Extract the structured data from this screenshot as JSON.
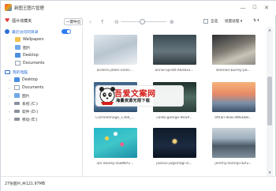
{
  "app": {
    "title": "新图王图片管理"
  },
  "window_controls": [
    "—",
    "☐",
    "✕"
  ],
  "sidebar": {
    "favorites_label": "图片收藏夹",
    "recent_label": "最近访问的目录",
    "recent_items": [
      {
        "label": "Wallpapers",
        "icon": "folder-icon"
      },
      {
        "label": "图片",
        "icon": "picture-folder-icon"
      },
      {
        "label": "Desktop",
        "icon": "desktop-icon"
      },
      {
        "label": "Documents",
        "icon": "document-icon"
      }
    ],
    "computer_label": "我的电脑",
    "computer_items": [
      {
        "label": "Desktop",
        "icon": "desktop-icon"
      },
      {
        "label": "Documents",
        "icon": "document-icon"
      },
      {
        "label": "图片",
        "icon": "picture-folder-icon"
      },
      {
        "label": "系统 (C:)",
        "icon": "drive-icon"
      },
      {
        "label": "软件 (D:)",
        "icon": "drive-icon"
      },
      {
        "label": "移动 (E:)",
        "icon": "drive-icon"
      }
    ]
  },
  "toolbar": {
    "import_label": "一键导出",
    "select_all_label": "全选",
    "batch_label": "批量处理 ▾",
    "sort_label": "⇅ ▾"
  },
  "gallery": {
    "items": [
      {
        "caption": "anders-jilden-xln01...",
        "style": "t1"
      },
      {
        "caption": "annie-spratt-Abnbxx...",
        "style": "t2"
      },
      {
        "caption": "bremen-burley-pa...",
        "style": "t3"
      },
      {
        "caption": "Cachedimage_1366_...",
        "style": "t4"
      },
      {
        "caption": "caleb-george-4kwP...",
        "style": "t5"
      },
      {
        "caption": "ethan-dow-dWEbBe...",
        "style": "t6"
      },
      {
        "caption": "ian-dooley-DuBNA1...",
        "style": "t7"
      },
      {
        "caption": "jaanus-jagomagi-sl...",
        "style": "t8"
      },
      {
        "caption": "jeremy-bishop-dZf2...",
        "style": "t9"
      }
    ]
  },
  "status": {
    "text": "27张图片,共121.97MB"
  },
  "watermark": {
    "title": "吾爱文案网",
    "subtitle": "海量资源无限下载"
  },
  "colors": {
    "accent": "#2e7df6",
    "watermark_red": "#d6201a"
  }
}
